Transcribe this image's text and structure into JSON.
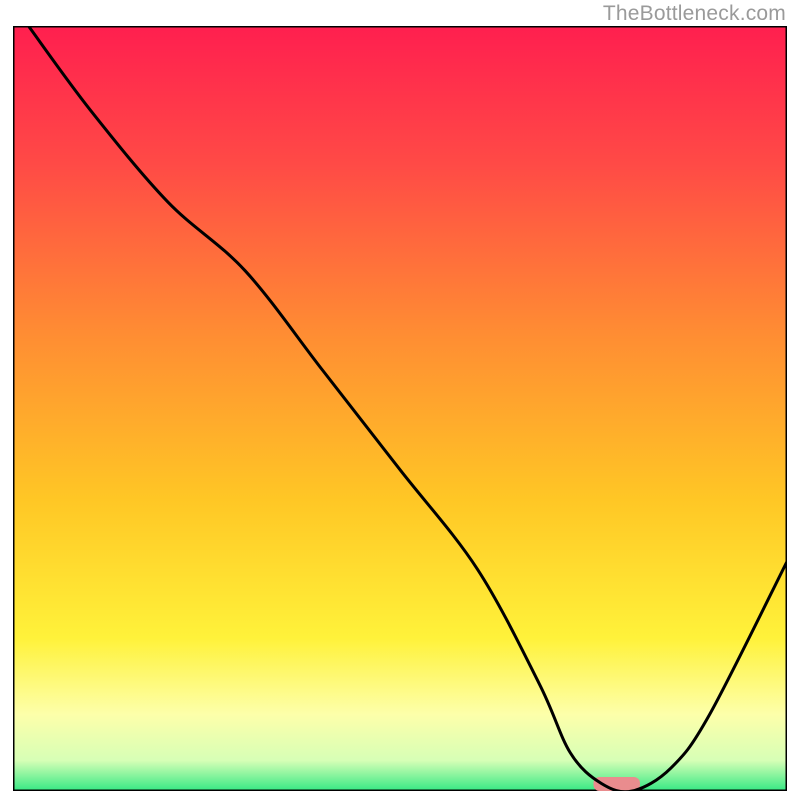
{
  "watermark": "TheBottleneck.com",
  "chart_data": {
    "type": "line",
    "title": "",
    "xlabel": "",
    "ylabel": "",
    "xlim": [
      0,
      100
    ],
    "ylim": [
      0,
      100
    ],
    "x": [
      2,
      10,
      20,
      30,
      40,
      50,
      60,
      68,
      72,
      76,
      80,
      85,
      90,
      100
    ],
    "values": [
      100,
      89,
      77,
      68,
      55,
      42,
      29,
      14,
      5,
      1,
      0,
      3,
      10,
      30
    ],
    "marker": {
      "x": 78,
      "y": 0,
      "width": 6,
      "color": "#e98c8e"
    },
    "gradient_stops": [
      {
        "offset": 0.0,
        "color": "#ff1f4f"
      },
      {
        "offset": 0.18,
        "color": "#ff4a46"
      },
      {
        "offset": 0.4,
        "color": "#ff8c33"
      },
      {
        "offset": 0.62,
        "color": "#ffc725"
      },
      {
        "offset": 0.8,
        "color": "#fff23a"
      },
      {
        "offset": 0.9,
        "color": "#fdffaa"
      },
      {
        "offset": 0.96,
        "color": "#d7ffb6"
      },
      {
        "offset": 1.0,
        "color": "#35e884"
      }
    ],
    "frame_color": "#000000",
    "frame_width": 3,
    "line_color": "#000000",
    "line_width": 3
  }
}
